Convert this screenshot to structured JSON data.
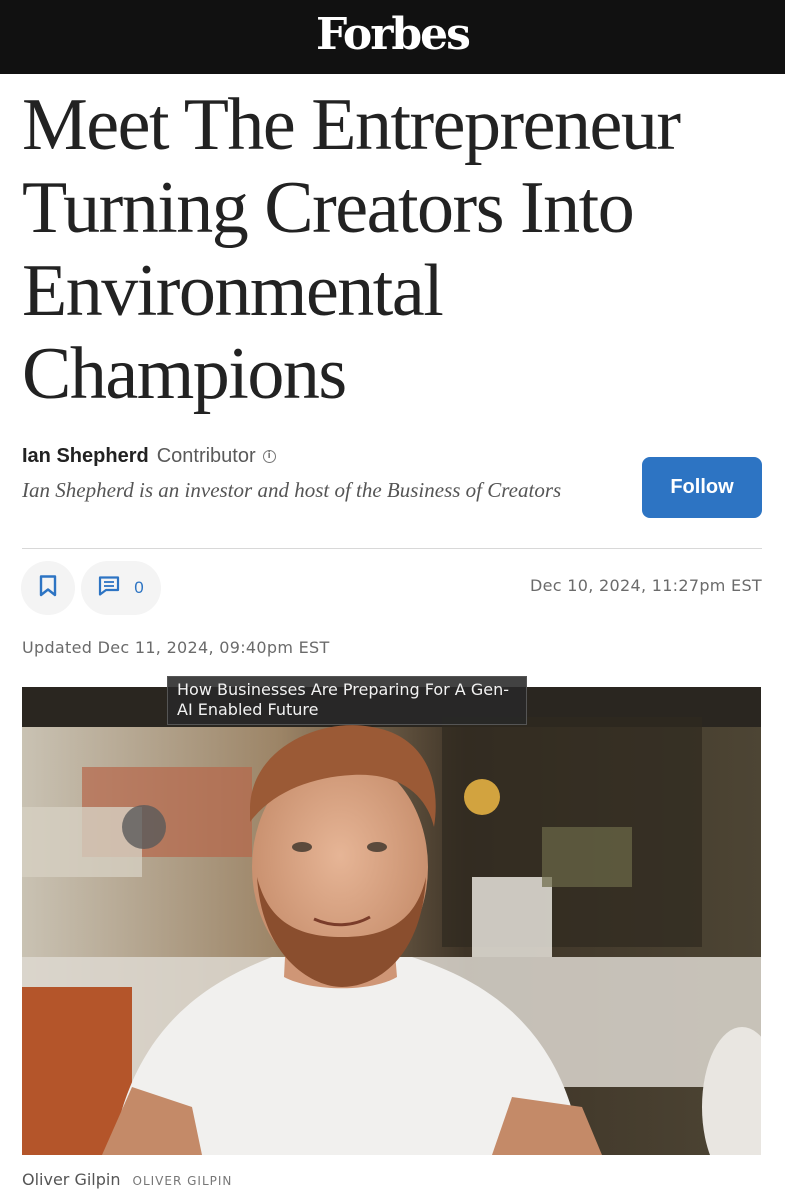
{
  "header": {
    "logo": "Forbes"
  },
  "article": {
    "title": "Meet The Entrepreneur Turning Creators Into Environmental Champions",
    "author": {
      "name": "Ian Shepherd",
      "role": "Contributor",
      "bio": "Ian Shepherd is an investor and host of the Business of Creators"
    },
    "follow_label": "Follow",
    "comment_count": "0",
    "published": "Dec 10, 2024, 11:27pm EST",
    "updated": "Updated Dec 11, 2024, 09:40pm EST",
    "tooltip": "How Businesses Are Preparing For A Gen-AI Enabled Future",
    "photo_credit": {
      "name": "Oliver Gilpin",
      "caps": "OLIVER GILPIN"
    }
  },
  "colors": {
    "topbar": "#111111",
    "accent": "#2d74c3",
    "headline": "#222222"
  },
  "icons": [
    "info-icon",
    "bookmark-icon",
    "comment-icon"
  ]
}
